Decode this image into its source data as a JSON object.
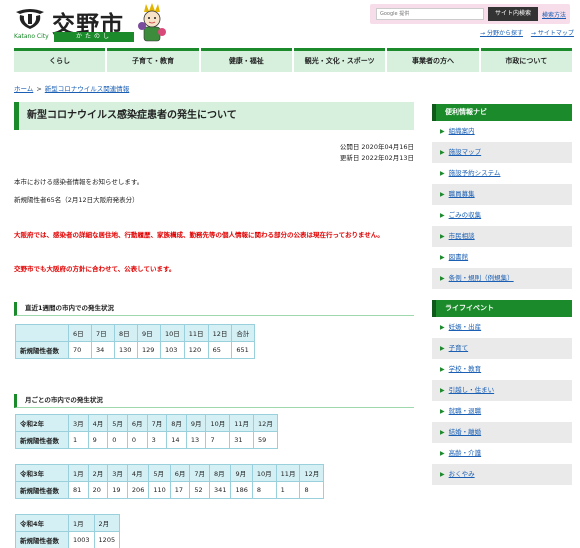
{
  "header": {
    "logo_text": "交野市",
    "logo_en": "Katano City",
    "logo_kana": "かたのし",
    "search_placeholder": "Google 提供",
    "search_button": "サイト内検索",
    "search_help": "検索方法",
    "util_links": [
      "分野から探す",
      "サイトマップ"
    ]
  },
  "nav": [
    "くらし",
    "子育て・教育",
    "健康・福祉",
    "観光・文化・スポーツ",
    "事業者の方へ",
    "市政について"
  ],
  "breadcrumb": [
    "ホーム",
    "新型コロナウイルス関連情報"
  ],
  "page": {
    "title": "新型コロナウイルス感染症患者の発生について",
    "published": "公開日 2020年04月16日",
    "updated": "更新日 2022年02月13日",
    "intro": "本市における感染者情報をお知らせします。",
    "new_count": "新規陽性者65名（2月12日大阪府発表分）",
    "warning1": "大阪府では、感染者の詳細な居住地、行動履歴、家族構成、勤務先等の個人情報に関わる部分の公表は現在行っておりません。",
    "warning2": "交野市でも大阪府の方針に合わせて、公表しています。"
  },
  "weekly": {
    "heading": "直近1週間の市内での発生状況",
    "headers": [
      "6日",
      "7日",
      "8日",
      "9日",
      "10日",
      "11日",
      "12日",
      "合計"
    ],
    "row_label": "新規陽性者数",
    "values": [
      "70",
      "34",
      "130",
      "129",
      "103",
      "120",
      "65",
      "651"
    ]
  },
  "monthly": {
    "heading": "月ごとの市内での発生状況",
    "row_label": "新規陽性者数",
    "tables": [
      {
        "year": "令和2年",
        "headers": [
          "3月",
          "4月",
          "5月",
          "6月",
          "7月",
          "8月",
          "9月",
          "10月",
          "11月",
          "12月"
        ],
        "values": [
          "1",
          "9",
          "0",
          "0",
          "3",
          "14",
          "13",
          "7",
          "31",
          "59"
        ]
      },
      {
        "year": "令和3年",
        "headers": [
          "1月",
          "2月",
          "3月",
          "4月",
          "5月",
          "6月",
          "7月",
          "8月",
          "9月",
          "10月",
          "11月",
          "12月"
        ],
        "values": [
          "81",
          "20",
          "19",
          "206",
          "110",
          "17",
          "52",
          "341",
          "186",
          "8",
          "1",
          "8"
        ]
      },
      {
        "year": "令和4年",
        "headers": [
          "1月",
          "2月"
        ],
        "values": [
          "1003",
          "1205"
        ]
      }
    ]
  },
  "sidebar": {
    "nav_heading": "便利情報ナビ",
    "nav_items": [
      "組織案内",
      "施設マップ",
      "施設予約システム",
      "職員募集",
      "ごみの収集",
      "市民相談",
      "図書館",
      "条例・規則（例規集）"
    ],
    "life_heading": "ライフイベント",
    "life_items": [
      "妊娠・出産",
      "子育て",
      "学校・教育",
      "引越し・住まい",
      "就職・退職",
      "結婚・離婚",
      "高齢・介護",
      "おくやみ"
    ]
  },
  "colors": {
    "accent": "#1a8a2a",
    "nav_bg": "#d6f0dd",
    "table_header": "#d4f0f4",
    "warning": "#e10000",
    "link": "#1a5fb4"
  }
}
